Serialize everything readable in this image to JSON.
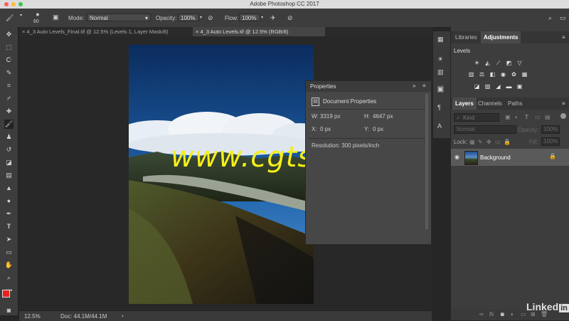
{
  "app": {
    "title": "Adobe Photoshop CC 2017"
  },
  "options_bar": {
    "brush_size": "60",
    "mode_label": "Mode:",
    "mode_value": "Normal",
    "opacity_label": "Opacity:",
    "opacity_value": "100%",
    "flow_label": "Flow:",
    "flow_value": "100%"
  },
  "doc_tabs": [
    {
      "label": "4_3 Auto Levels_Final.tif @ 12.5% (Levels 1, Layer Mask/8)"
    },
    {
      "label": "4_3 Auto Levels.tif @ 12.5% (RGB/8)"
    }
  ],
  "status_bar": {
    "zoom": "12.5%",
    "doc": "Doc: 44.1M/44.1M"
  },
  "properties_panel": {
    "title": "Properties",
    "section": "Document Properties",
    "w_label": "W:",
    "w_value": "3319 px",
    "h_label": "H:",
    "h_value": "4647 px",
    "x_label": "X:",
    "x_value": "0 px",
    "y_label": "Y:",
    "y_value": "0 px",
    "resolution": "Resolution: 300 pixels/inch"
  },
  "adjustments_panel": {
    "tabs": [
      "Libraries",
      "Adjustments"
    ],
    "active_tab": "Adjustments",
    "hover_label": "Levels"
  },
  "layers_panel": {
    "tabs": [
      "Layers",
      "Channels",
      "Paths"
    ],
    "filter_placeholder": "Kind",
    "blend_mode": "Normal",
    "opacity_label": "Opacity:",
    "opacity_value": "100%",
    "lock_label": "Lock:",
    "fill_label": "Fill:",
    "fill_value": "100%",
    "layers": [
      {
        "name": "Background",
        "visible": true,
        "locked": true
      }
    ]
  },
  "watermark": {
    "text": "www.cgtsj.com",
    "brand": "Linked"
  },
  "colors": {
    "foreground": "#e8201f",
    "background": "#ffffff",
    "watermark": "#f5ee1a"
  }
}
